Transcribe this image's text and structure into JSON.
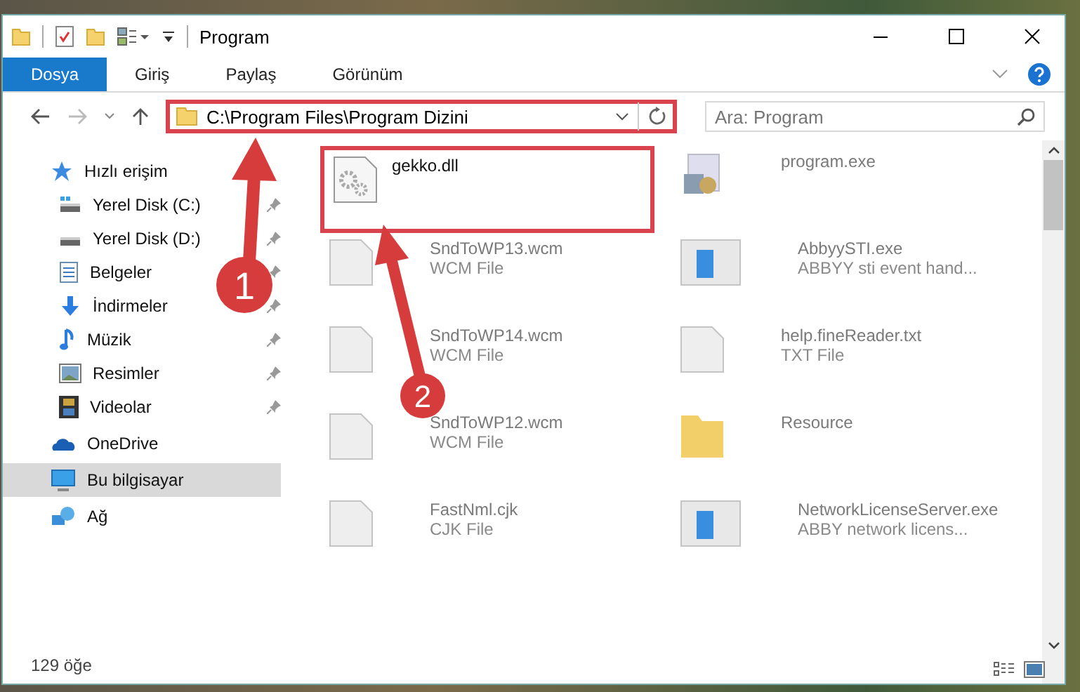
{
  "window": {
    "title": "Program"
  },
  "ribbon_tabs": [
    {
      "label": "Dosya",
      "selected": true
    },
    {
      "label": "Giriş",
      "selected": false
    },
    {
      "label": "Paylaş",
      "selected": false
    },
    {
      "label": "Görünüm",
      "selected": false
    }
  ],
  "address_bar": {
    "value": "C:\\Program Files\\Program Dizini",
    "highlighted": true
  },
  "search": {
    "placeholder": "Ara: Program"
  },
  "sidebar": {
    "items": [
      {
        "label": "Hızlı erişim",
        "kind": "quick",
        "pinned": false,
        "selected": false,
        "children": [
          {
            "label": "Yerel Disk (C:)",
            "kind": "disk-c",
            "pinned": true,
            "selected": false
          },
          {
            "label": "Yerel Disk (D:)",
            "kind": "disk",
            "pinned": true,
            "selected": false
          },
          {
            "label": "Belgeler",
            "kind": "docs",
            "pinned": true,
            "selected": false
          },
          {
            "label": "İndirmeler",
            "kind": "downloads",
            "pinned": true,
            "selected": false
          },
          {
            "label": "Müzik",
            "kind": "music",
            "pinned": true,
            "selected": false
          },
          {
            "label": "Resimler",
            "kind": "pictures",
            "pinned": true,
            "selected": false
          },
          {
            "label": "Videolar",
            "kind": "videos",
            "pinned": true,
            "selected": false
          }
        ]
      },
      {
        "label": "OneDrive",
        "kind": "cloud",
        "pinned": false,
        "selected": false
      },
      {
        "label": "Bu bilgisayar",
        "kind": "pc",
        "pinned": false,
        "selected": true
      },
      {
        "label": "Ağ",
        "kind": "network",
        "pinned": false,
        "selected": false
      }
    ]
  },
  "files": [
    {
      "name": "gekko.dll",
      "kind": "dll",
      "highlighted": true,
      "faded": false
    },
    {
      "name": "program.exe",
      "kind": "exe",
      "highlighted": false,
      "faded": true
    },
    {
      "name": "SndToWP13.wcm",
      "type": "WCM File",
      "kind": "doc",
      "highlighted": false,
      "faded": true
    },
    {
      "name": "AbbyySTI.exe",
      "type": "ABBYY sti event hand...",
      "kind": "app",
      "highlighted": false,
      "faded": true
    },
    {
      "name": "SndToWP14.wcm",
      "type": "WCM File",
      "kind": "doc",
      "highlighted": false,
      "faded": true
    },
    {
      "name": "help.fineReader.txt",
      "type": "TXT File",
      "kind": "doc",
      "highlighted": false,
      "faded": true
    },
    {
      "name": "SndToWP12.wcm",
      "type": "WCM File",
      "kind": "doc",
      "highlighted": false,
      "faded": true
    },
    {
      "name": "Resource",
      "kind": "folder",
      "highlighted": false,
      "faded": true
    },
    {
      "name": "FastNml.cjk",
      "type": "CJK File",
      "kind": "doc",
      "highlighted": false,
      "faded": true
    },
    {
      "name": "NetworkLicenseServer.exe",
      "type": "ABBY network licens...",
      "kind": "app",
      "highlighted": false,
      "faded": true
    }
  ],
  "annotations": [
    {
      "number": "1"
    },
    {
      "number": "2"
    }
  ],
  "status_bar": {
    "count": "129 öğe"
  }
}
